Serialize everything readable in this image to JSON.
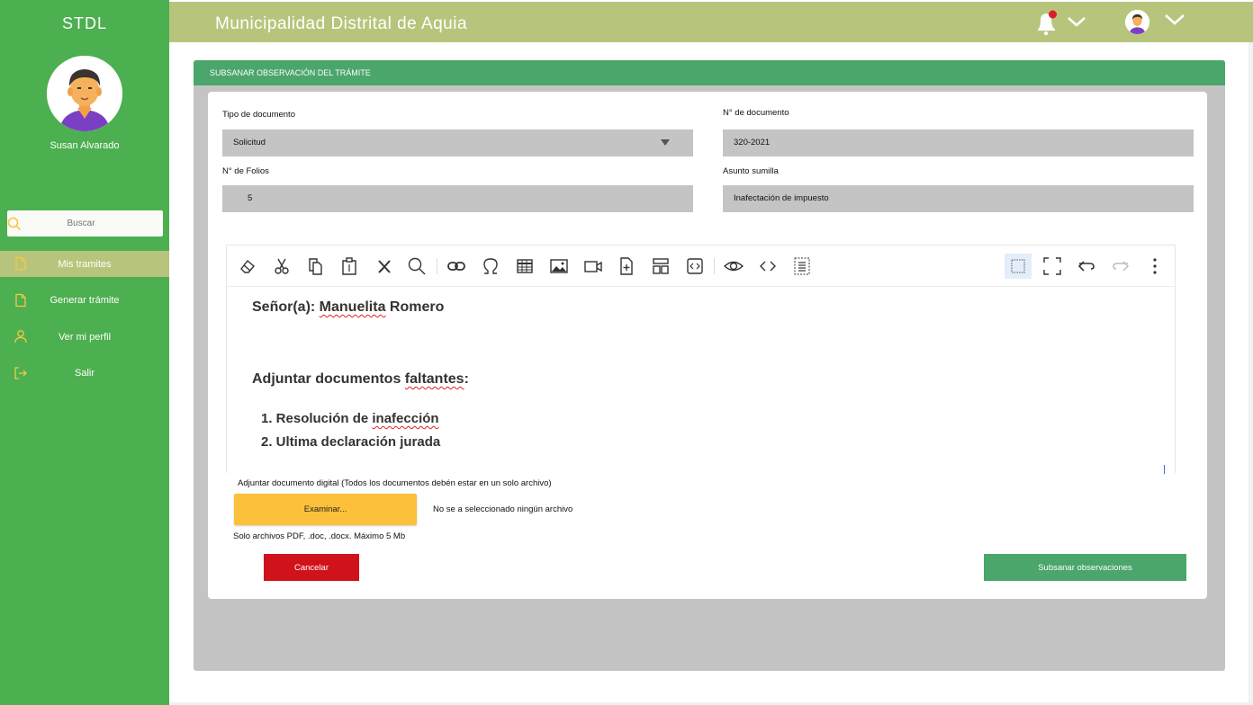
{
  "sidebar": {
    "brand": "STDL",
    "user_name": "Susan Alvarado",
    "search_placeholder": "Buscar",
    "items": [
      {
        "label": "Mis tramites",
        "icon": "file-icon",
        "active": true
      },
      {
        "label": "Generar trámite",
        "icon": "file-icon",
        "active": false
      },
      {
        "label": "Ver mi perfil",
        "icon": "user-icon",
        "active": false
      },
      {
        "label": "Salir",
        "icon": "logout-icon",
        "active": false
      }
    ]
  },
  "topbar": {
    "title": "Municipalidad Distrital de Aquia"
  },
  "panel": {
    "heading": "SUBSANAR OBSERVACIÓN DEL TRÁMITE"
  },
  "form": {
    "tipo_label": "Tipo de documento",
    "tipo_value": "Solicitud",
    "numdoc_label": "N° de documento",
    "numdoc_value": "320-2021",
    "folios_label": "N° de Folios",
    "folios_value": "5",
    "asunto_label": "Asunto sumilla",
    "asunto_value": "Inafectación de impuesto"
  },
  "editor": {
    "greeting_prefix": "Señor(a): ",
    "greeting_name": "Manuelita",
    "greeting_last": " Romero",
    "adjuntar_prefix": "Adjuntar documentos ",
    "adjuntar_word": "faltantes",
    "adjuntar_suffix": ":",
    "item1_prefix": "1. Resolución de ",
    "item1_word": "inafección",
    "item2": "2. Ultima declaración jurada"
  },
  "upload": {
    "label": "Adjuntar documento digital (Todos los documentos debén estar en un solo archivo)",
    "browse_label": "Examinar...",
    "no_file": "No se a seleccionado ningún archivo",
    "hint": "Solo archivos PDF,  .doc,  .docx. Máximo 5 Mb"
  },
  "actions": {
    "cancel_label": "Cancelar",
    "submit_label": "Subsanar observaciones"
  },
  "colors": {
    "sidebar": "#4caf50",
    "topbar": "#b7c57c",
    "panel_head": "#4aa66a",
    "browse": "#fcc03b",
    "cancel": "#d0131a",
    "nav_icon": "#f5c842"
  }
}
